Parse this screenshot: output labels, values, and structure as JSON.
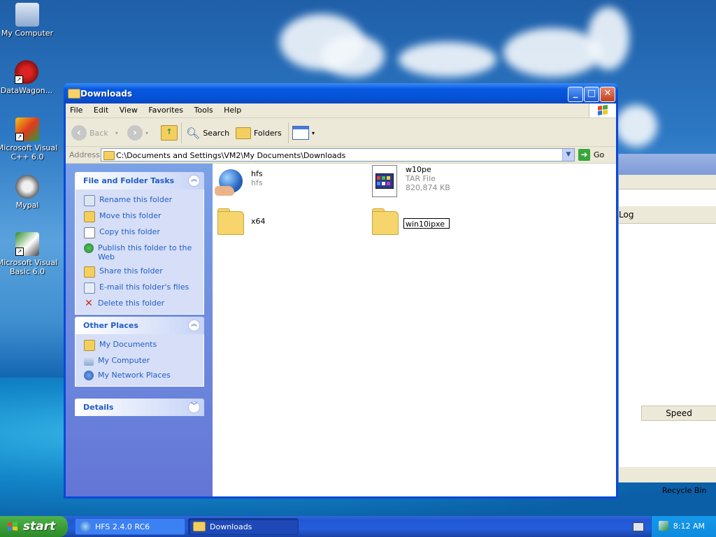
{
  "desktop": {
    "icons": [
      {
        "label": "My Computer"
      },
      {
        "label": "DataWagon..."
      },
      {
        "label": "Microsoft Visual C++ 6.0"
      },
      {
        "label": "Mypal"
      },
      {
        "label": "Microsoft Visual Basic 6.0"
      }
    ],
    "recycle_bin_label": "Recycle Bin"
  },
  "background_window": {
    "column_log": "Log",
    "column_speed": "Speed"
  },
  "window": {
    "title": "Downloads",
    "menu": [
      "File",
      "Edit",
      "View",
      "Favorites",
      "Tools",
      "Help"
    ],
    "toolbar": {
      "back_label": "Back",
      "search_label": "Search",
      "folders_label": "Folders"
    },
    "address": {
      "label": "Address",
      "value": "C:\\Documents and Settings\\VM2\\My Documents\\Downloads",
      "go_label": "Go"
    },
    "task_pane": {
      "file_folder_tasks": {
        "title": "File and Folder Tasks",
        "items": [
          "Rename this folder",
          "Move this folder",
          "Copy this folder",
          "Publish this folder to the Web",
          "Share this folder",
          "E-mail this folder's files",
          "Delete this folder"
        ]
      },
      "other_places": {
        "title": "Other Places",
        "items": [
          "My Documents",
          "My Computer",
          "My Network Places"
        ]
      },
      "details": {
        "title": "Details"
      }
    },
    "files": [
      {
        "name": "hfs",
        "subtitle": "hfs",
        "type": "app"
      },
      {
        "name": "w10pe",
        "subtitle": "TAR File",
        "size": "820,874 KB",
        "type": "tar"
      },
      {
        "name": "x64",
        "type": "folder"
      },
      {
        "name": "",
        "type": "folder"
      }
    ],
    "rename_value": "win10ipxe"
  },
  "taskbar": {
    "start_label": "start",
    "tasks": [
      {
        "label": "HFS 2.4.0 RC6",
        "active": false
      },
      {
        "label": "Downloads",
        "active": true
      }
    ],
    "clock": "8:12 AM"
  },
  "colors": {
    "link_blue": "#215dc6",
    "titlebar_blue": "#0552d6",
    "taskpane_blue": "#6375d6",
    "start_green": "#3c9f39"
  }
}
